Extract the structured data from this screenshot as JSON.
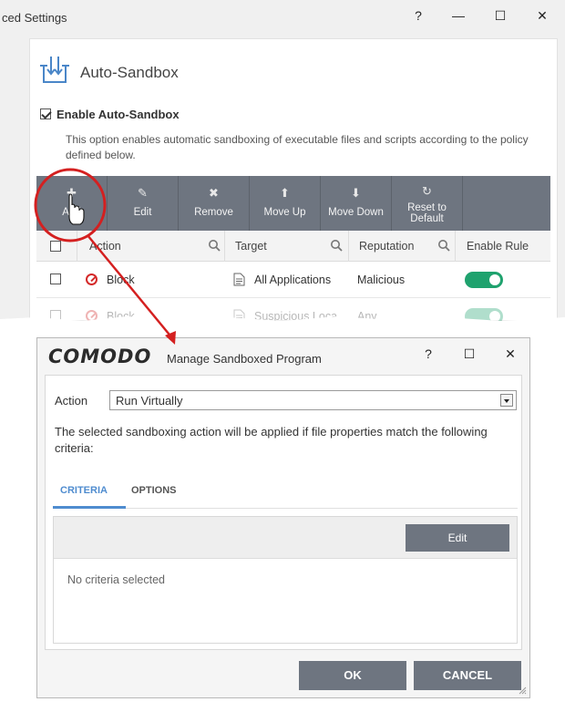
{
  "settings_window": {
    "title": "ced Settings",
    "controls": {
      "help": "?",
      "minimize": "—",
      "maximize": "☐",
      "close": "✕"
    },
    "section_title": "Auto-Sandbox",
    "enable_label": "Enable Auto-Sandbox",
    "enable_checked": true,
    "description": "This option enables automatic sandboxing of executable files and scripts according to the policy defined below.",
    "toolbar": [
      {
        "icon": "plus-icon",
        "glyph": "✚",
        "label": "Add"
      },
      {
        "icon": "pencil-icon",
        "glyph": "✎",
        "label": "Edit"
      },
      {
        "icon": "x-icon",
        "glyph": "✖",
        "label": "Remove"
      },
      {
        "icon": "arrow-up-icon",
        "glyph": "⬆",
        "label": "Move Up"
      },
      {
        "icon": "arrow-down-icon",
        "glyph": "⬇",
        "label": "Move Down"
      },
      {
        "icon": "refresh-icon",
        "glyph": "↻",
        "label": "Reset to Default"
      }
    ],
    "columns": {
      "action": "Action",
      "target": "Target",
      "reputation": "Reputation",
      "enable_rule": "Enable Rule"
    },
    "rows": [
      {
        "action": "Block",
        "target": "All Applications",
        "reputation": "Malicious",
        "enabled": true
      },
      {
        "action": "Block",
        "target": "Suspicious Loca...",
        "reputation": "Any",
        "enabled": true
      }
    ]
  },
  "dialog": {
    "logo": "COMODO",
    "title": "Manage Sandboxed Program",
    "controls": {
      "help": "?",
      "maximize": "☐",
      "close": "✕"
    },
    "action_label": "Action",
    "action_value": "Run Virtually",
    "criteria_text": "The selected sandboxing action will be applied if file properties match the following criteria:",
    "tabs": [
      "CRITERIA",
      "OPTIONS"
    ],
    "active_tab": "CRITERIA",
    "edit_label": "Edit",
    "empty_text": "No criteria selected",
    "ok_label": "OK",
    "cancel_label": "CANCEL"
  },
  "colors": {
    "toolbar": "#6e7580",
    "toggle_on": "#1fa26e",
    "highlight": "#d42020",
    "tab_active": "#4f8ccf"
  }
}
